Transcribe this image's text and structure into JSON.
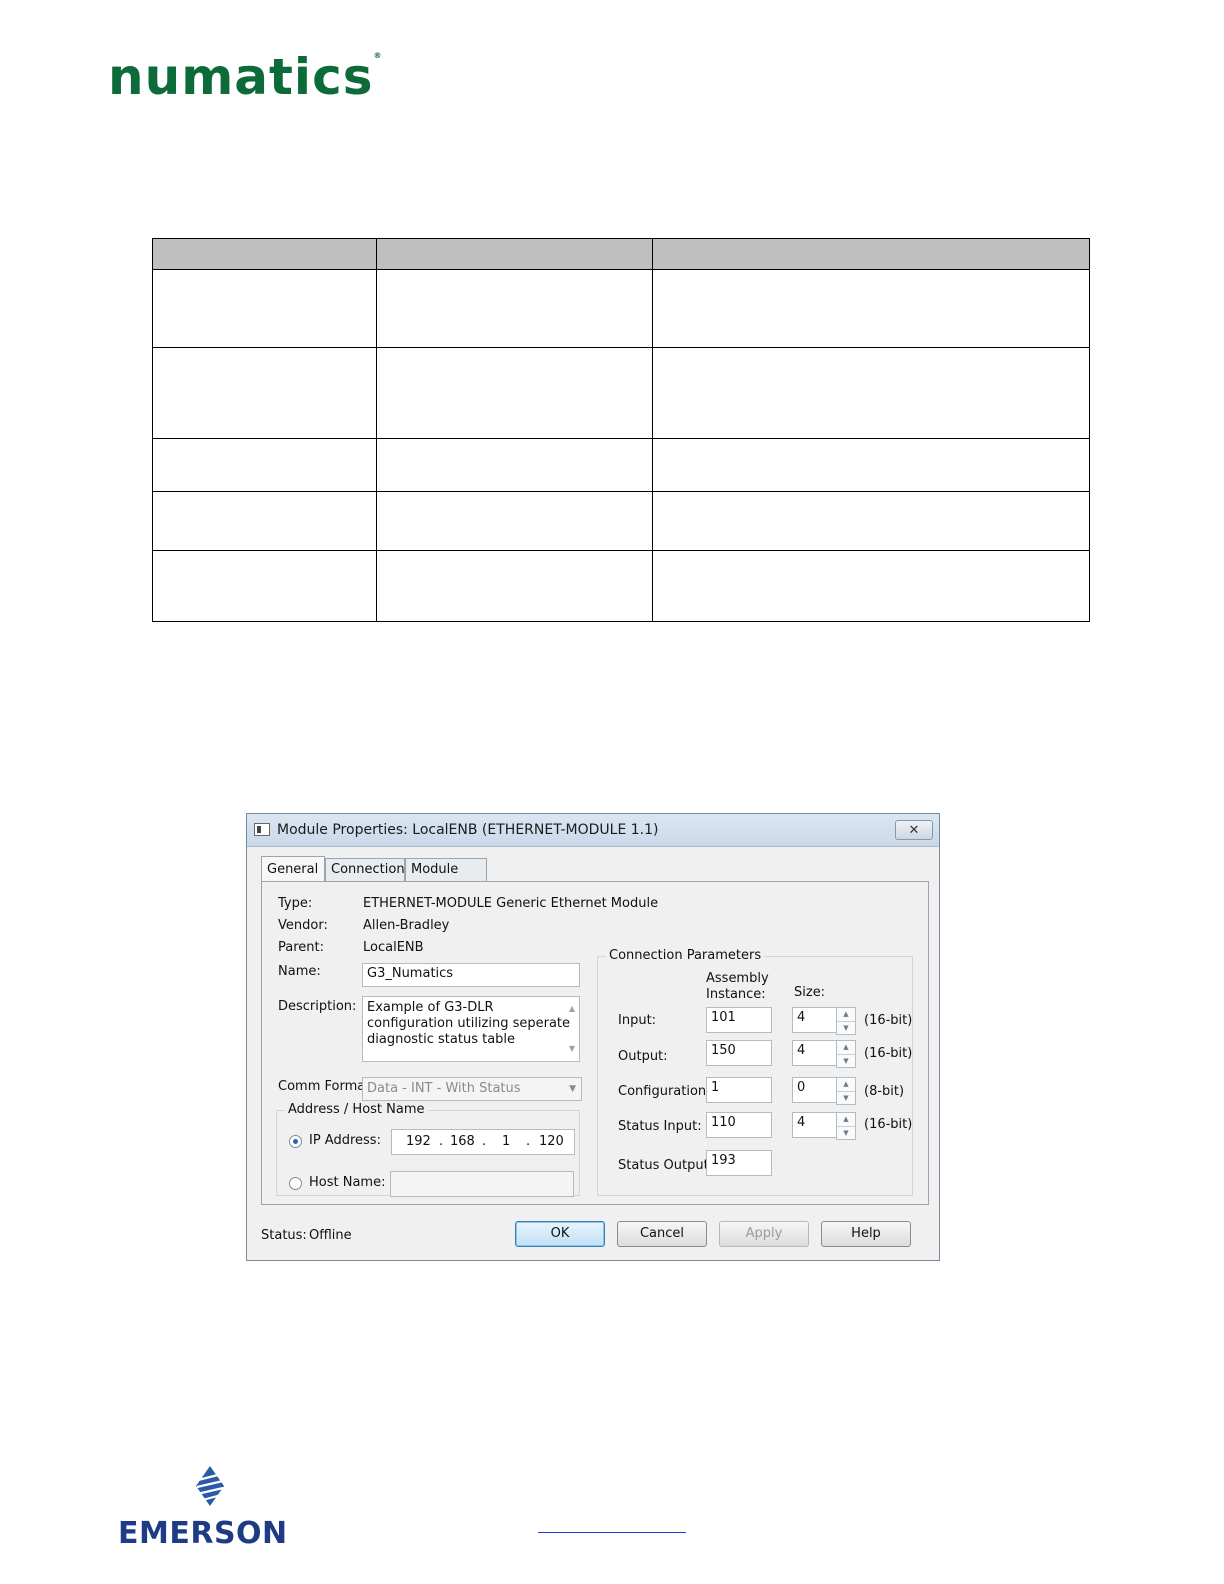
{
  "brand": {
    "logo_text": "numatics",
    "footer_logo_text": "EMERSON"
  },
  "table": {
    "rows": 5,
    "columns": 3
  },
  "dialog": {
    "title": "Module Properties: LocalENB (ETHERNET-MODULE 1.1)",
    "close_glyph": "✕",
    "tabs": [
      {
        "label": "General",
        "active": true
      },
      {
        "label": "Connection",
        "active": false
      },
      {
        "label": "Module Info",
        "active": false
      }
    ],
    "general": {
      "type_label": "Type:",
      "type_value": "ETHERNET-MODULE Generic Ethernet Module",
      "vendor_label": "Vendor:",
      "vendor_value": "Allen-Bradley",
      "parent_label": "Parent:",
      "parent_value": "LocalENB",
      "name_label": "Name:",
      "name_value": "G3_Numatics",
      "description_label": "Description:",
      "description_lines": [
        "Example of G3-DLR",
        "configuration utilizing seperate",
        "diagnostic status table"
      ],
      "comm_format_label": "Comm Format:",
      "comm_format_value": "Data - INT - With Status",
      "address_group_title": "Address / Host Name",
      "ip_label": "IP Address:",
      "ip_octets": [
        "192",
        "168",
        "1",
        "120"
      ],
      "host_label": "Host Name:",
      "host_value": ""
    },
    "connection_parameters": {
      "group_title": "Connection Parameters",
      "assembly_header_line1": "Assembly",
      "assembly_header_line2": "Instance:",
      "size_header": "Size:",
      "rows": [
        {
          "label": "Input:",
          "instance": "101",
          "size": "4",
          "unit": "(16-bit)"
        },
        {
          "label": "Output:",
          "instance": "150",
          "size": "4",
          "unit": "(16-bit)"
        },
        {
          "label": "Configuration:",
          "instance": "1",
          "size": "0",
          "unit": "(8-bit)"
        },
        {
          "label": "Status Input:",
          "instance": "110",
          "size": "4",
          "unit": "(16-bit)"
        },
        {
          "label": "Status Output:",
          "instance": "193"
        }
      ]
    },
    "status_label": "Status:",
    "status_value": "Offline",
    "buttons": {
      "ok": "OK",
      "cancel": "Cancel",
      "apply": "Apply",
      "help": "Help"
    }
  }
}
